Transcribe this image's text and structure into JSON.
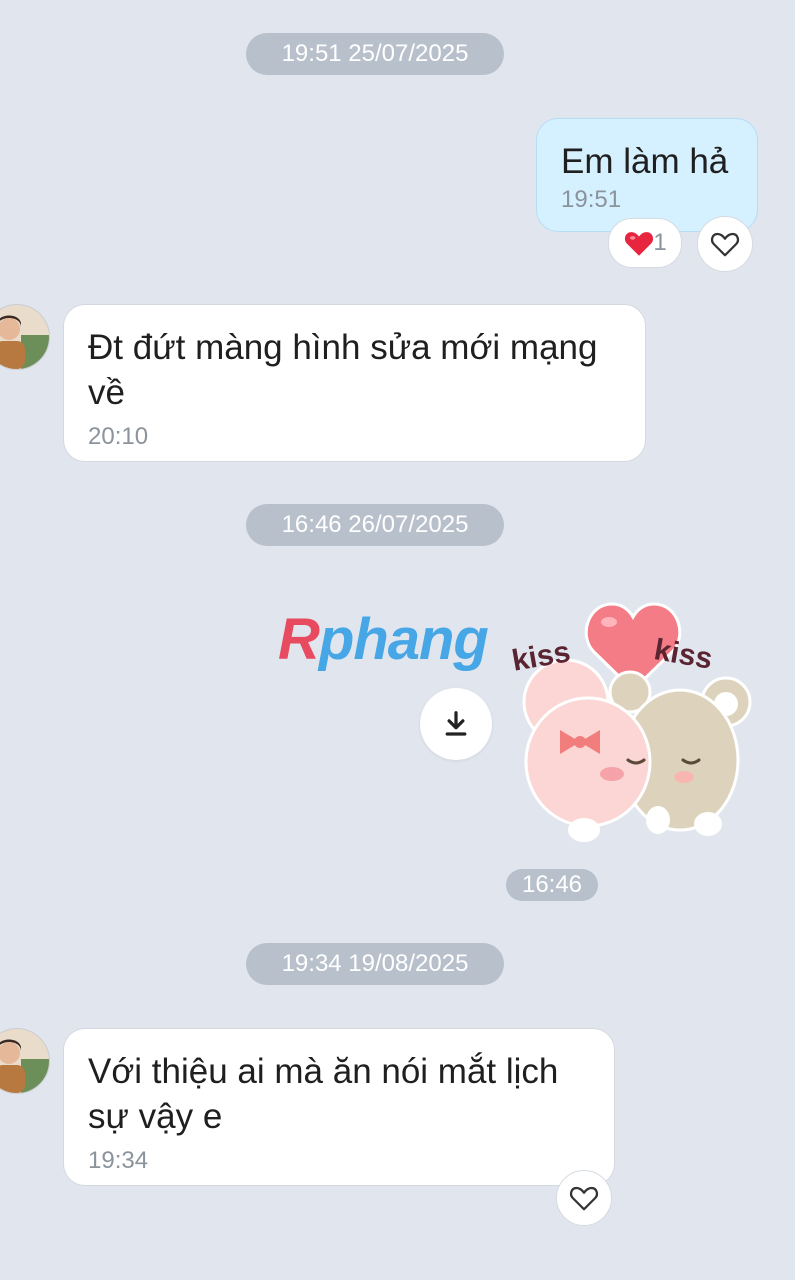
{
  "dates": [
    "19:51 25/07/2025",
    "16:46 26/07/2025",
    "19:34 19/08/2025"
  ],
  "messages": [
    {
      "text": "Em làm hả",
      "time": "19:51",
      "direction": "outgoing",
      "reaction_count": "1"
    },
    {
      "text": "Đt đứt màng hình sửa mới mạng về",
      "time": "20:10",
      "direction": "incoming"
    },
    {
      "text": "Với thiệu ai mà ăn nói mắt lịch sự vậy e",
      "time": "19:34",
      "direction": "incoming"
    }
  ],
  "sticker": {
    "time": "16:46",
    "kiss_left": "kiss",
    "kiss_right": "kiss",
    "watermark_first": "R",
    "watermark_rest": "phang"
  },
  "icons": {
    "reaction": "heart-filled-icon",
    "react": "heart-outline-icon",
    "download": "download-icon"
  },
  "colors": {
    "background": "#e1e6ee",
    "outgoing_bubble": "#d5f0fe",
    "incoming_bubble": "#ffffff",
    "date_pill": "#b8c0cb",
    "reaction_heart": "#e8253f"
  }
}
